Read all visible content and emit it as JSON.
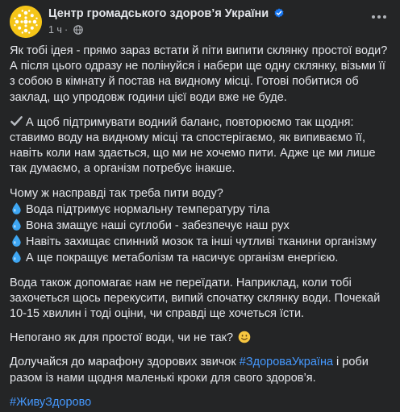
{
  "header": {
    "page_name": "Центр громадського здоров’я України",
    "time": "1 ч",
    "separator": "·",
    "avatar_icon": "phc-ukraine-logo",
    "verified_icon": "verified-badge-icon",
    "privacy_icon": "globe-icon",
    "more_icon": "more-options-icon"
  },
  "post": {
    "p1": "Як тобі ідея - прямо зараз встати й піти випити склянку простої води? А після цього одразу не полінуйся і набери ще одну склянку, візьми її з собою в кімнату й постав на видному місці. Готові побитися об заклад, що упродовж години цієї води вже не буде.",
    "p2": "А щоб підтримувати водний баланс, повторюємо так щодня: ставимо воду на видному місці та спостерігаємо, як випиваємо її, навіть коли нам здається, що ми не хочемо пити. Адже це ми лише так думаємо, а організм потребує інакше.",
    "p3_intro": "Чому ж насправді так треба пити воду?",
    "bullets": [
      "Вода підтримує нормальну температуру тіла",
      "Вона змащує наші суглоби - забезпечує наш рух",
      "Навіть захищає спинний мозок та інші чутливі тканини організму",
      "А ще покращує метаболізм та насичує організм енергією."
    ],
    "p4": "Вода також допомагає нам не переїдати. Наприклад, коли тобі захочеться щось перекусити, випий спочатку склянку води. Почекай 10-15 хвилин і тоді оціни, чи справді ще хочеться їсти.",
    "p5": "Непогано як для простої води, чи не так?",
    "p6_before": "Долучайся до марафону здорових звичок ",
    "p6_hashtag": "#ЗдороваУкраїна",
    "p6_after": " і роби разом із нами щодня маленькі кроки для свого здоров’я.",
    "hashtag": "#ЖивуЗдорово"
  },
  "colors": {
    "background": "#242526",
    "text": "#e4e6eb",
    "secondary_text": "#b0b3b8",
    "link": "#4599ff",
    "avatar": "#f5c518"
  }
}
